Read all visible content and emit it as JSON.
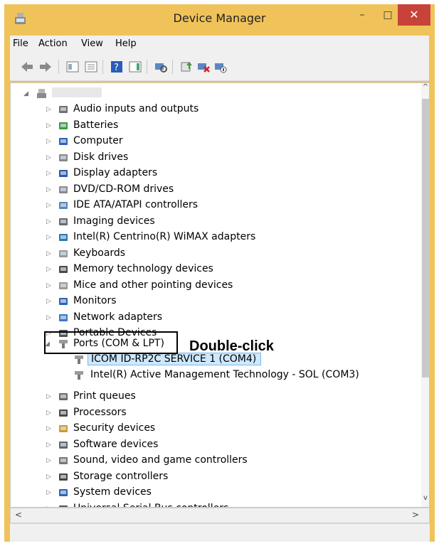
{
  "window": {
    "title": "Device Manager",
    "minimize_glyph": "–",
    "maximize_glyph": "□",
    "close_glyph": "✕"
  },
  "menu": [
    {
      "label": "File"
    },
    {
      "label": "Action"
    },
    {
      "label": "View"
    },
    {
      "label": "Help"
    }
  ],
  "toolbar": [
    "back-icon",
    "forward-icon",
    "properties-icon",
    "console-tree-icon",
    "help-icon",
    "action-pane-icon",
    "scan-hardware-icon",
    "update-driver-icon",
    "uninstall-device-icon",
    "disable-device-icon"
  ],
  "tree": {
    "root_label": "",
    "categories": [
      {
        "label": "Audio inputs and outputs",
        "icon": "speaker-icon"
      },
      {
        "label": "Batteries",
        "icon": "battery-icon"
      },
      {
        "label": "Computer",
        "icon": "computer-icon"
      },
      {
        "label": "Disk drives",
        "icon": "disk-drive-icon"
      },
      {
        "label": "Display adapters",
        "icon": "display-adapter-icon"
      },
      {
        "label": "DVD/CD-ROM drives",
        "icon": "dvd-drive-icon"
      },
      {
        "label": "IDE ATA/ATAPI controllers",
        "icon": "ide-controller-icon"
      },
      {
        "label": "Imaging devices",
        "icon": "imaging-icon"
      },
      {
        "label": "Intel(R) Centrino(R) WiMAX adapters",
        "icon": "wimax-icon"
      },
      {
        "label": "Keyboards",
        "icon": "keyboard-icon"
      },
      {
        "label": "Memory technology devices",
        "icon": "memory-icon"
      },
      {
        "label": "Mice and other pointing devices",
        "icon": "mouse-icon"
      },
      {
        "label": "Monitors",
        "icon": "monitor-icon"
      },
      {
        "label": "Network adapters",
        "icon": "network-icon"
      },
      {
        "label": "Portable Devices",
        "icon": "portable-device-icon"
      }
    ],
    "ports": {
      "label": "Ports (COM & LPT)",
      "children": [
        {
          "label": "ICOM ID-RP2C SERVICE 1 (COM4)"
        },
        {
          "label": "Intel(R) Active Management Technology - SOL (COM3)"
        }
      ]
    },
    "categories_after": [
      {
        "label": "Print queues",
        "icon": "printer-icon"
      },
      {
        "label": "Processors",
        "icon": "processor-icon"
      },
      {
        "label": "Security devices",
        "icon": "security-icon"
      },
      {
        "label": "Software devices",
        "icon": "software-icon"
      },
      {
        "label": "Sound, video and game controllers",
        "icon": "sound-icon"
      },
      {
        "label": "Storage controllers",
        "icon": "storage-icon"
      },
      {
        "label": "System devices",
        "icon": "system-icon"
      },
      {
        "label": "Universal Serial Bus controllers",
        "icon": "usb-icon"
      }
    ]
  },
  "scroll": {
    "up": "^",
    "down": "v",
    "left": "<",
    "right": ">"
  },
  "annotation": {
    "text": "Double-click"
  }
}
